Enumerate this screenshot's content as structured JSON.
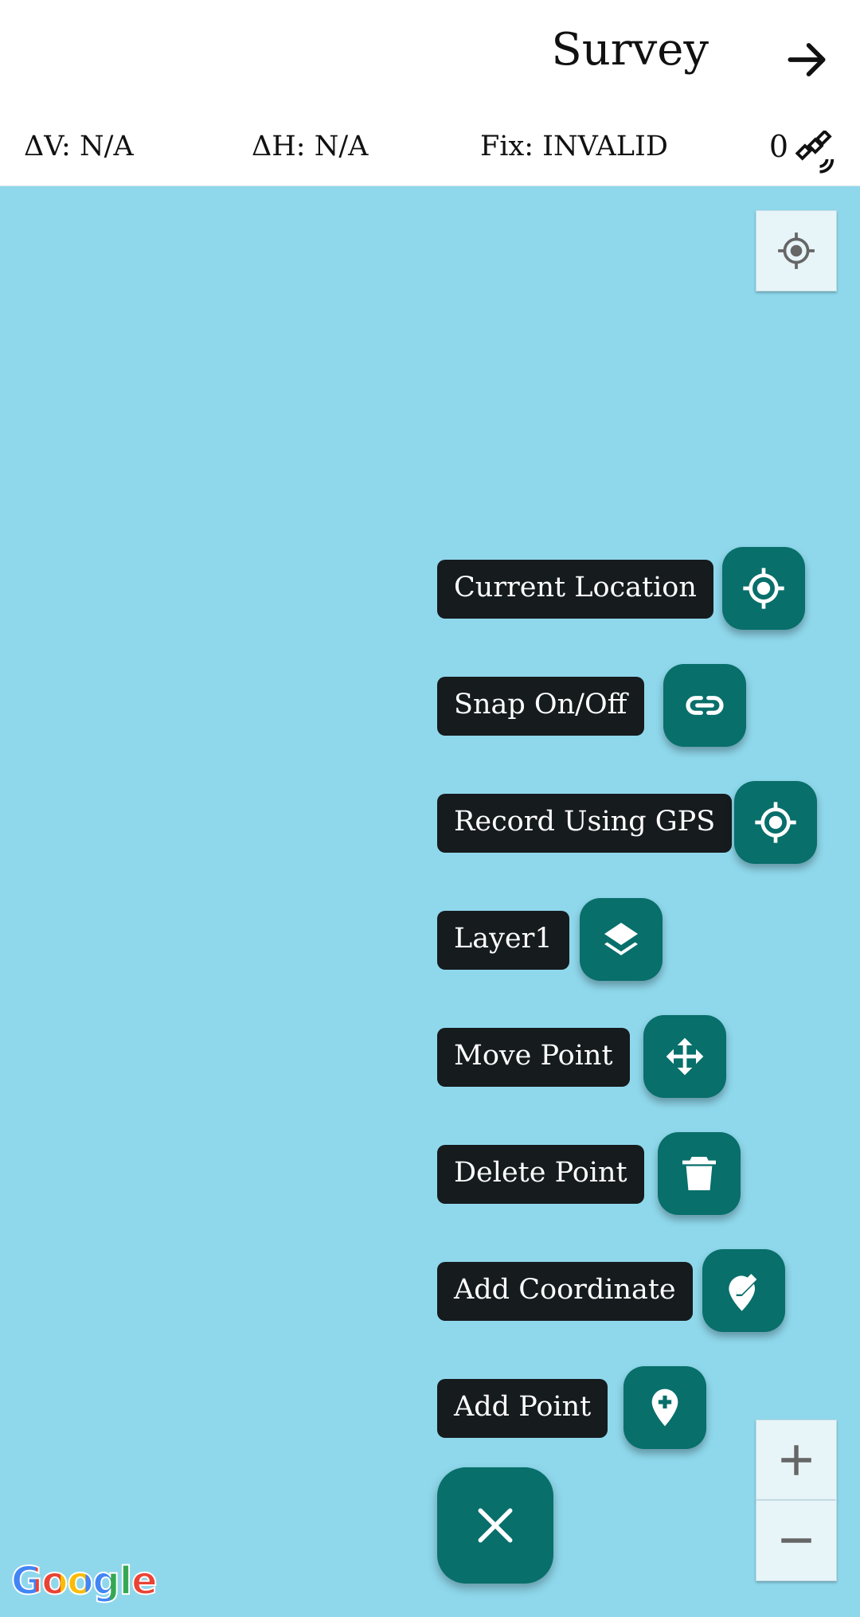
{
  "header": {
    "title": "Survey",
    "forward_icon": "arrow-right-icon"
  },
  "status": {
    "delta_v": "ΔV: N/A",
    "delta_h": "ΔH: N/A",
    "fix": "Fix: INVALID",
    "satellite_count": "0",
    "satellite_icon": "satellite-icon"
  },
  "map": {
    "background_color": "#8fd8ec",
    "my_location_icon": "my-location-icon",
    "zoom_in_icon": "plus-icon",
    "zoom_out_icon": "minus-icon",
    "attribution": "Google"
  },
  "fab_menu": {
    "items": [
      {
        "label": "Current Location",
        "icon": "crosshair-icon"
      },
      {
        "label": "Snap On/Off",
        "icon": "link-icon"
      },
      {
        "label": "Record Using GPS",
        "icon": "crosshair-icon"
      },
      {
        "label": "Layer1",
        "icon": "layers-icon"
      },
      {
        "label": "Move Point",
        "icon": "move-icon"
      },
      {
        "label": "Delete Point",
        "icon": "trash-icon"
      },
      {
        "label": "Add Coordinate",
        "icon": "edit-location-icon"
      },
      {
        "label": "Add Point",
        "icon": "add-location-icon"
      }
    ],
    "close_icon": "close-icon",
    "accent_color": "#086f6b"
  }
}
